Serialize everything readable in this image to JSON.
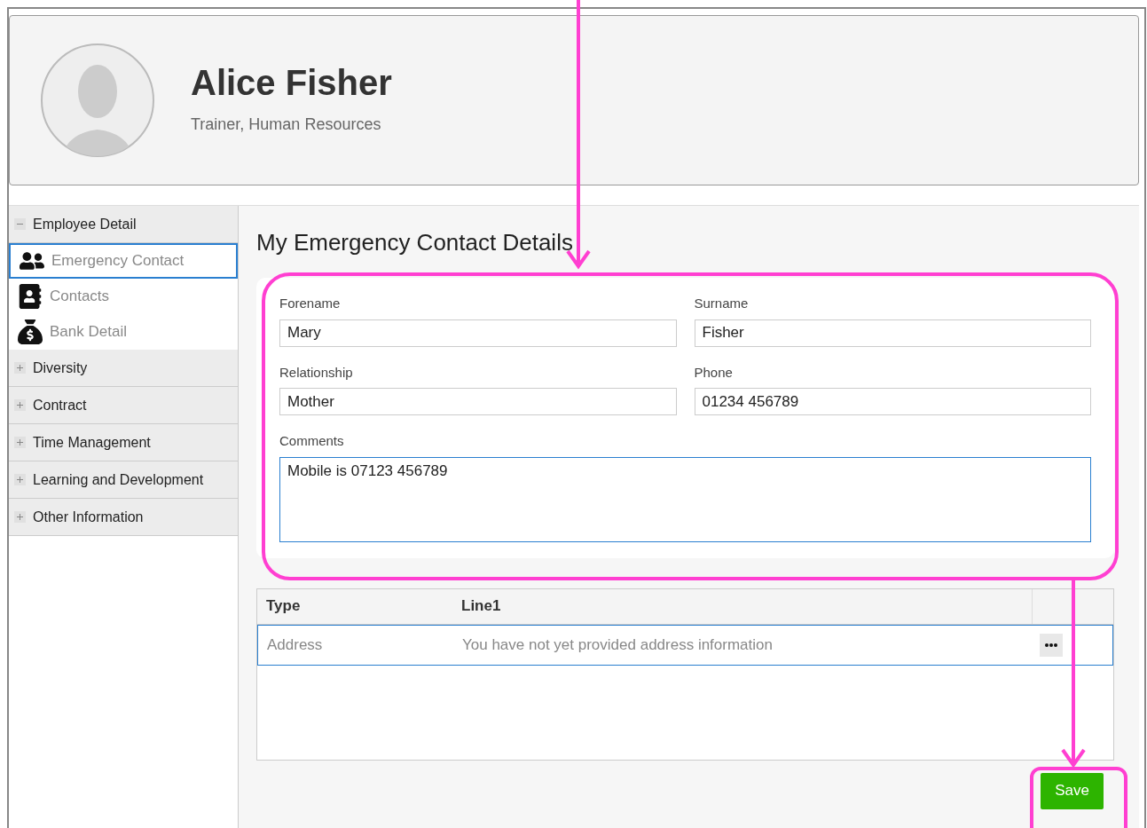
{
  "profile": {
    "name": "Alice Fisher",
    "subtitle": "Trainer, Human Resources"
  },
  "sidebar": {
    "sections": [
      {
        "label": "Employee Detail",
        "expanded": true,
        "children": [
          {
            "label": "Emergency Contact",
            "selected": true
          },
          {
            "label": "Contacts",
            "selected": false
          },
          {
            "label": "Bank Detail",
            "selected": false
          }
        ]
      },
      {
        "label": "Diversity",
        "expanded": false
      },
      {
        "label": "Contract",
        "expanded": false
      },
      {
        "label": "Time Management",
        "expanded": false
      },
      {
        "label": "Learning and Development",
        "expanded": false
      },
      {
        "label": "Other Information",
        "expanded": false
      }
    ]
  },
  "page_title": "My Emergency Contact Details",
  "form": {
    "fields": [
      {
        "label": "Forename",
        "value": "Mary",
        "kind": "input"
      },
      {
        "label": "Surname",
        "value": "Fisher",
        "kind": "input"
      },
      {
        "label": "Relationship",
        "value": "Mother",
        "kind": "input"
      },
      {
        "label": "Phone",
        "value": "01234 456789",
        "kind": "input"
      },
      {
        "label": "Comments",
        "value": "Mobile is 07123 456789",
        "kind": "textarea"
      }
    ]
  },
  "table": {
    "columns": [
      "Type",
      "Line1"
    ],
    "rows": [
      {
        "cells": [
          "Address",
          "You have not yet provided address information"
        ],
        "selected": true
      }
    ]
  },
  "save_button": "Save"
}
